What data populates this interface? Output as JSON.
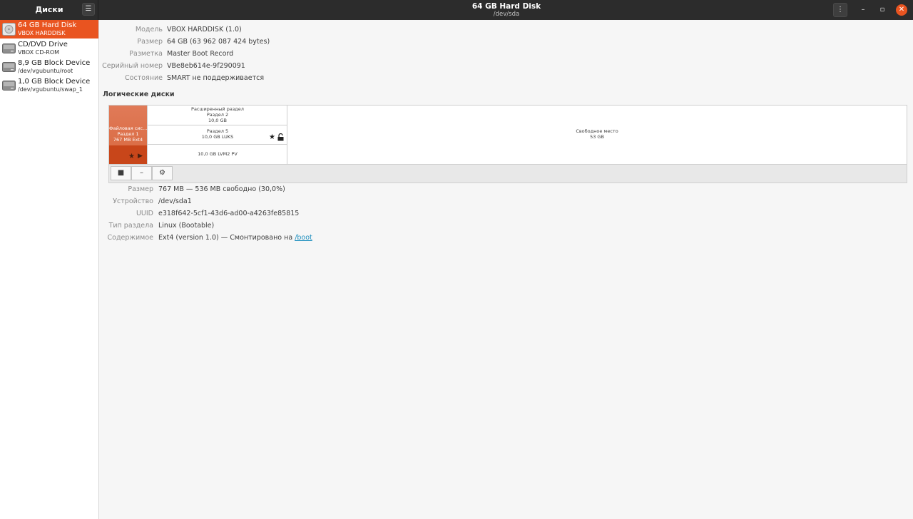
{
  "header": {
    "app_title": "Диски",
    "menu_glyph": "☰",
    "title": "64 GB Hard Disk",
    "subtitle": "/dev/sda",
    "kebab_glyph": "⋮",
    "minimize_glyph": "–",
    "maximize_glyph": "▫",
    "close_glyph": "✕"
  },
  "sidebar": {
    "items": [
      {
        "name": "64 GB Hard Disk",
        "sub": "VBOX HARDDISK",
        "icon": "hard-disk-icon"
      },
      {
        "name": "CD/DVD Drive",
        "sub": "VBOX CD-ROM",
        "icon": "optical-drive-icon"
      },
      {
        "name": "8,9 GB Block Device",
        "sub": "/dev/vgubuntu/root",
        "icon": "block-device-icon"
      },
      {
        "name": "1,0 GB Block Device",
        "sub": "/dev/vgubuntu/swap_1",
        "icon": "block-device-icon"
      }
    ]
  },
  "drive": {
    "model_label": "Модель",
    "model": "VBOX HARDDISK (1.0)",
    "size_label": "Размер",
    "size": "64 GB (63 962 087 424 bytes)",
    "partitioning_label": "Разметка",
    "partitioning": "Master Boot Record",
    "serial_label": "Серийный номер",
    "serial": "VBe8eb614e-9f290091",
    "state_label": "Состояние",
    "state": "SMART не поддерживается"
  },
  "volumes": {
    "title": "Логические диски",
    "p1": {
      "line1": "Файловая сис...",
      "line2": "Раздел 1",
      "line3": "767 MB Ext4"
    },
    "extended": {
      "line1": "Расширенный раздел",
      "line2": "Раздел 2",
      "line3": "10,0 GB"
    },
    "luks": {
      "line1": "Раздел 5",
      "line2": "10,0 GB LUKS"
    },
    "lvm": {
      "line1": "10,0 GB LVM2 PV"
    },
    "free": {
      "line1": "Свободное место",
      "line2": "53 GB"
    }
  },
  "toolbar": {
    "stop_glyph": "■",
    "delete_glyph": "–",
    "settings_glyph": "⚙"
  },
  "partition": {
    "size_label": "Размер",
    "size": "767 MB — 536 MB свободно (30,0%)",
    "device_label": "Устройство",
    "device": "/dev/sda1",
    "uuid_label": "UUID",
    "uuid": "e318f642-5cf1-43d6-ad00-a4263fe85815",
    "type_label": "Тип раздела",
    "type": "Linux (Bootable)",
    "contents_label": "Содержимое",
    "contents": "Ext4 (version 1.0) — Смонтировано на ",
    "mount_link": "/boot"
  },
  "colors": {
    "accent": "#e95420",
    "headerbar": "#2c2c2c",
    "link": "#1e8fbf"
  }
}
